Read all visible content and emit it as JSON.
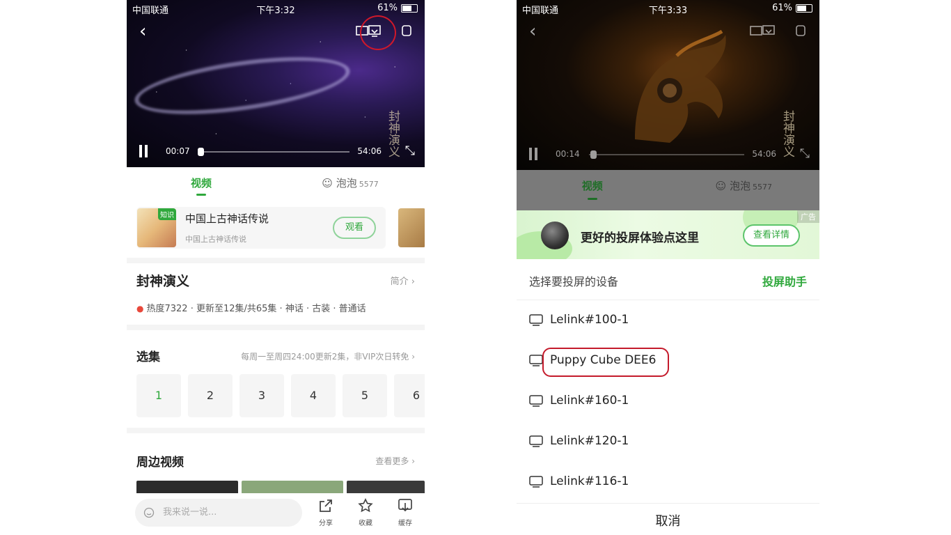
{
  "left": {
    "status_bar": {
      "carrier": "中国联通",
      "time": "下午3:32",
      "battery": "61%"
    },
    "player": {
      "current_time": "00:07",
      "total_time": "54:06",
      "watermark": "封神演义",
      "progress": 0.02
    },
    "tabs": [
      {
        "label": "视频"
      },
      {
        "label": "泡泡",
        "count": "5577"
      }
    ],
    "promo": {
      "tag": "知识",
      "title": "中国上古神话传说",
      "subtitle": "中国上古神话传说",
      "button": "观看"
    },
    "show": {
      "title": "封神演义",
      "intro_link": "简介",
      "meta": "热度7322 · 更新至12集/共65集 · 神话 · 古装 · 普通话"
    },
    "episodes": {
      "title": "选集",
      "note": "每周一至周四24:00更新2集，非VIP次日转免",
      "items": [
        "1",
        "2",
        "3",
        "4",
        "5",
        "6"
      ]
    },
    "nearby": {
      "title": "周边视频",
      "more": "查看更多"
    },
    "bottom": {
      "comment_placeholder": "我来说一说...",
      "share": "分享",
      "favorite": "收藏",
      "cache": "缓存"
    }
  },
  "right": {
    "status_bar": {
      "carrier": "中国联通",
      "time": "下午3:33",
      "battery": "61%"
    },
    "player": {
      "current_time": "00:14",
      "total_time": "54:06",
      "watermark": "封神演义",
      "progress": 0.04
    },
    "tabs": [
      {
        "label": "视频"
      },
      {
        "label": "泡泡",
        "count": "5577"
      }
    ],
    "ad": {
      "text": "更好的投屏体验点这里",
      "button": "查看详情",
      "tag": "广告"
    },
    "sheet": {
      "title": "选择要投屏的设备",
      "helper": "投屏助手",
      "cancel": "取消"
    },
    "devices": [
      "Lelink#100-1",
      "Puppy Cube DEE6",
      "Lelink#160-1",
      "Lelink#120-1",
      "Lelink#116-1"
    ]
  },
  "colors": {
    "accent": "#2fa83c",
    "highlight": "#c41a2b"
  }
}
